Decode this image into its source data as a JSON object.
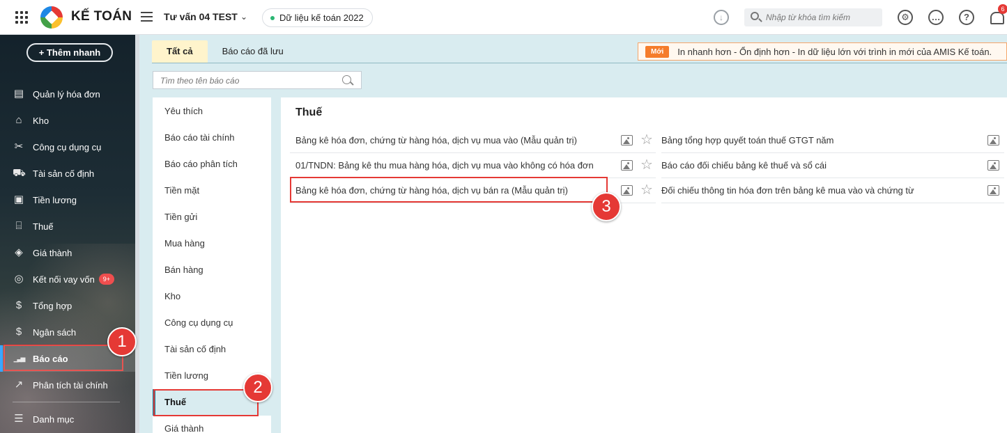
{
  "header": {
    "app_title": "KẾ TOÁN",
    "company": "Tư vấn 04 TEST",
    "data_label": "Dữ liệu kế toán 2022",
    "search_placeholder": "Nhập từ khóa tìm kiếm",
    "notification_count": "6"
  },
  "sidebar": {
    "quick_add": "+ Thêm nhanh",
    "items": [
      {
        "label": "Quản lý hóa đơn",
        "icon": "invoice-icon",
        "glyph": "▤"
      },
      {
        "label": "Kho",
        "icon": "warehouse-icon",
        "glyph": "⌂"
      },
      {
        "label": "Công cụ dụng cụ",
        "icon": "tools-icon",
        "glyph": "✂"
      },
      {
        "label": "Tài sản cố định",
        "icon": "asset-icon",
        "glyph": "⛟"
      },
      {
        "label": "Tiền lương",
        "icon": "salary-icon",
        "glyph": "▣"
      },
      {
        "label": "Thuế",
        "icon": "tax-icon",
        "glyph": "⌸"
      },
      {
        "label": "Giá thành",
        "icon": "cost-icon",
        "glyph": "◈"
      },
      {
        "label": "Kết nối vay vốn",
        "icon": "loan-icon",
        "glyph": "◎",
        "badge": "9+"
      },
      {
        "label": "Tổng hợp",
        "icon": "summary-icon",
        "glyph": "$"
      },
      {
        "label": "Ngân sách",
        "icon": "budget-icon",
        "glyph": "$"
      },
      {
        "label": "Báo cáo",
        "icon": "report-icon",
        "glyph": "▁▃▅",
        "active": true
      },
      {
        "label": "Phân tích tài chính",
        "icon": "analysis-icon",
        "glyph": "↗"
      },
      {
        "label": "Danh mục",
        "icon": "catalog-icon",
        "glyph": "☰"
      }
    ]
  },
  "tabs": [
    {
      "label": "Tất cả",
      "active": true
    },
    {
      "label": "Báo cáo đã lưu",
      "active": false
    }
  ],
  "banner": {
    "tag": "Mới",
    "text": "In nhanh hơn - Ổn định hơn - In dữ liệu lớn với trình in mới của AMIS Kế toán."
  },
  "report_search_placeholder": "Tìm theo tên báo cáo",
  "categories": [
    "Yêu thích",
    "Báo cáo tài chính",
    "Báo cáo phân tích",
    "Tiền mặt",
    "Tiền gửi",
    "Mua hàng",
    "Bán hàng",
    "Kho",
    "Công cụ dụng cụ",
    "Tài sản cố định",
    "Tiền lương",
    "Thuế",
    "Giá thành"
  ],
  "active_category": "Thuế",
  "section_title": "Thuế",
  "reports_left": [
    "Bảng kê hóa đơn, chứng từ hàng hóa, dịch vụ mua vào (Mẫu quản trị)",
    "01/TNDN: Bảng kê thu mua hàng hóa, dịch vụ mua vào không có hóa đơn",
    "Bảng kê hóa đơn, chứng từ hàng hóa, dịch vụ bán ra (Mẫu quản trị)"
  ],
  "reports_right": [
    "Bảng tổng hợp quyết toán thuế GTGT năm",
    "Báo cáo đối chiếu bảng kê thuế và sổ cái",
    "Đối chiếu thông tin hóa đơn trên bảng kê mua vào và chứng từ"
  ],
  "annotations": [
    "1",
    "2",
    "3"
  ],
  "colors": {
    "annotation": "#e53935",
    "active_tab": "#fff4cc",
    "banner_tag": "#f57c2b",
    "sidebar_bg": "#14222b"
  }
}
